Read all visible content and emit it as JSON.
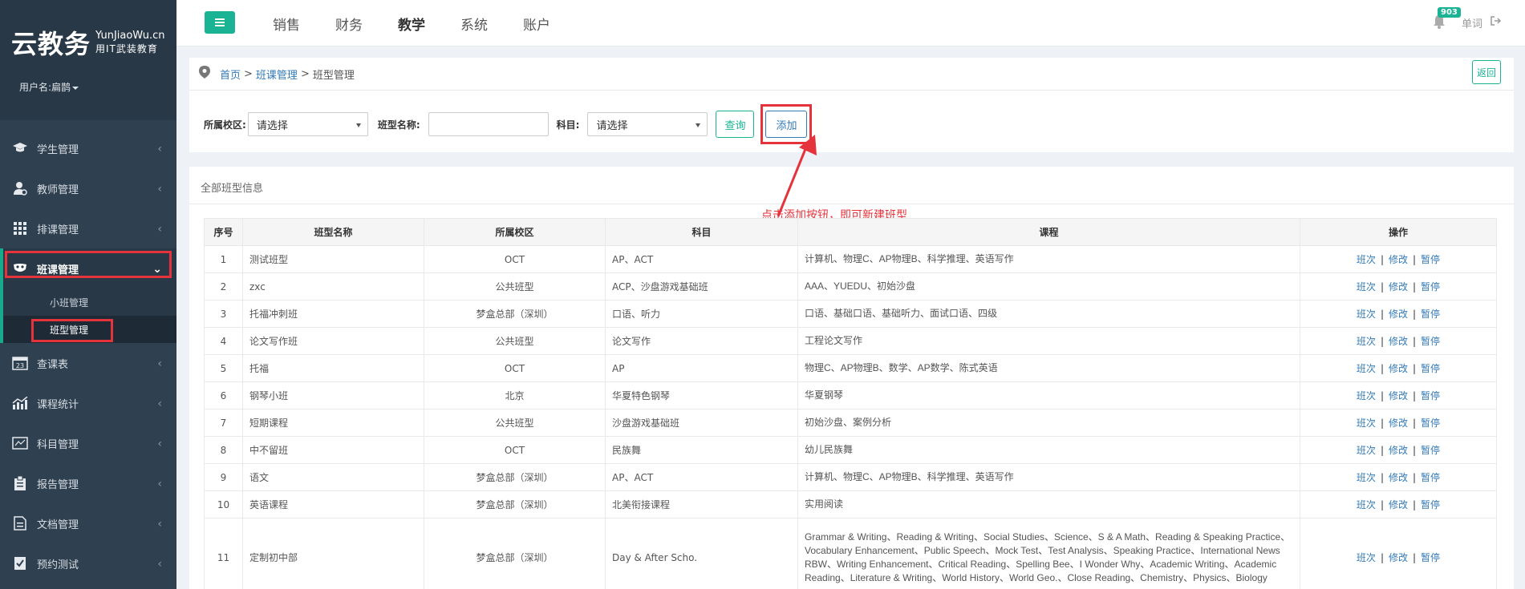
{
  "sidebar": {
    "logo_cn": "云教务",
    "logo_en": "YunJiaoWu.cn",
    "logo_slogan": "用IT武装教育",
    "username": "用户名:扁鹊",
    "items": [
      {
        "label": "学生管理",
        "icon": "graduation-cap-icon"
      },
      {
        "label": "教师管理",
        "icon": "user-icon"
      },
      {
        "label": "排课管理",
        "icon": "grid-icon"
      },
      {
        "label": "班课管理",
        "icon": "mask-icon"
      },
      {
        "label": "查课表",
        "icon": "calendar-icon"
      },
      {
        "label": "课程统计",
        "icon": "chart-icon"
      },
      {
        "label": "科目管理",
        "icon": "subject-icon"
      },
      {
        "label": "报告管理",
        "icon": "clipboard-icon"
      },
      {
        "label": "文档管理",
        "icon": "document-icon"
      },
      {
        "label": "预约测试",
        "icon": "test-icon"
      }
    ],
    "calendar_num": "23",
    "subitems": [
      "小班管理",
      "班型管理"
    ]
  },
  "topbar": {
    "tabs": [
      "销售",
      "财务",
      "教学",
      "系统",
      "账户"
    ],
    "active_tab": "教学",
    "badge": "903",
    "user": "单词"
  },
  "breadcrumb": {
    "home": "首页",
    "sep": ">",
    "parent": "班课管理",
    "current": "班型管理",
    "back": "返回"
  },
  "filters": {
    "campus_label": "所属校区:",
    "campus_value": "请选择",
    "name_label": "班型名称:",
    "subject_label": "科目:",
    "subject_value": "请选择",
    "query": "查询",
    "add": "添加"
  },
  "list": {
    "title": "全部班型信息",
    "annotation": "点击添加按钮，即可新建班型",
    "columns": [
      "序号",
      "班型名称",
      "所属校区",
      "科目",
      "课程",
      "操作"
    ],
    "ops": [
      "班次",
      "修改",
      "暂停"
    ],
    "rows": [
      [
        "1",
        "测试班型",
        "OCT",
        "AP、ACT",
        "计算机、物理C、AP物理B、科学推理、英语写作"
      ],
      [
        "2",
        "zxc",
        "公共班型",
        "ACP、沙盘游戏基础班",
        "AAA、YUEDU、初始沙盘"
      ],
      [
        "3",
        "托福冲刺班",
        "梦盒总部（深圳）",
        "口语、听力",
        "口语、基础口语、基础听力、面试口语、四级"
      ],
      [
        "4",
        "论文写作班",
        "公共班型",
        "论文写作",
        "工程论文写作"
      ],
      [
        "5",
        "托福",
        "OCT",
        "AP",
        "物理C、AP物理B、数学、AP数学、陈式英语"
      ],
      [
        "6",
        "钢琴小班",
        "北京",
        "华夏特色钢琴",
        "华夏钢琴"
      ],
      [
        "7",
        "短期课程",
        "公共班型",
        "沙盘游戏基础班",
        "初始沙盘、案例分析"
      ],
      [
        "8",
        "中不留班",
        "OCT",
        "民族舞",
        "幼儿民族舞"
      ],
      [
        "9",
        "语文",
        "梦盒总部（深圳）",
        "AP、ACT",
        "计算机、物理C、AP物理B、科学推理、英语写作"
      ],
      [
        "10",
        "英语课程",
        "梦盒总部（深圳）",
        "北美衔接课程",
        "实用阅读"
      ],
      [
        "11",
        "定制初中部",
        "梦盒总部（深圳）",
        "Day & After Scho.",
        "Grammar & Writing、Reading & Writing、Social Studies、Science、S & A Math、Reading & Speaking Practice、Vocabulary Enhancement、Public Speech、Mock Test、Test Analysis、Speaking Practice、International News RBW、Writing Enhancement、Critical Reading、Spelling Bee、I Wonder Why、Academic Writing、Academic Reading、Literature & Writing、World History、World Geo.、Close Reading、Chemistry、Physics、Biology"
      ]
    ]
  }
}
